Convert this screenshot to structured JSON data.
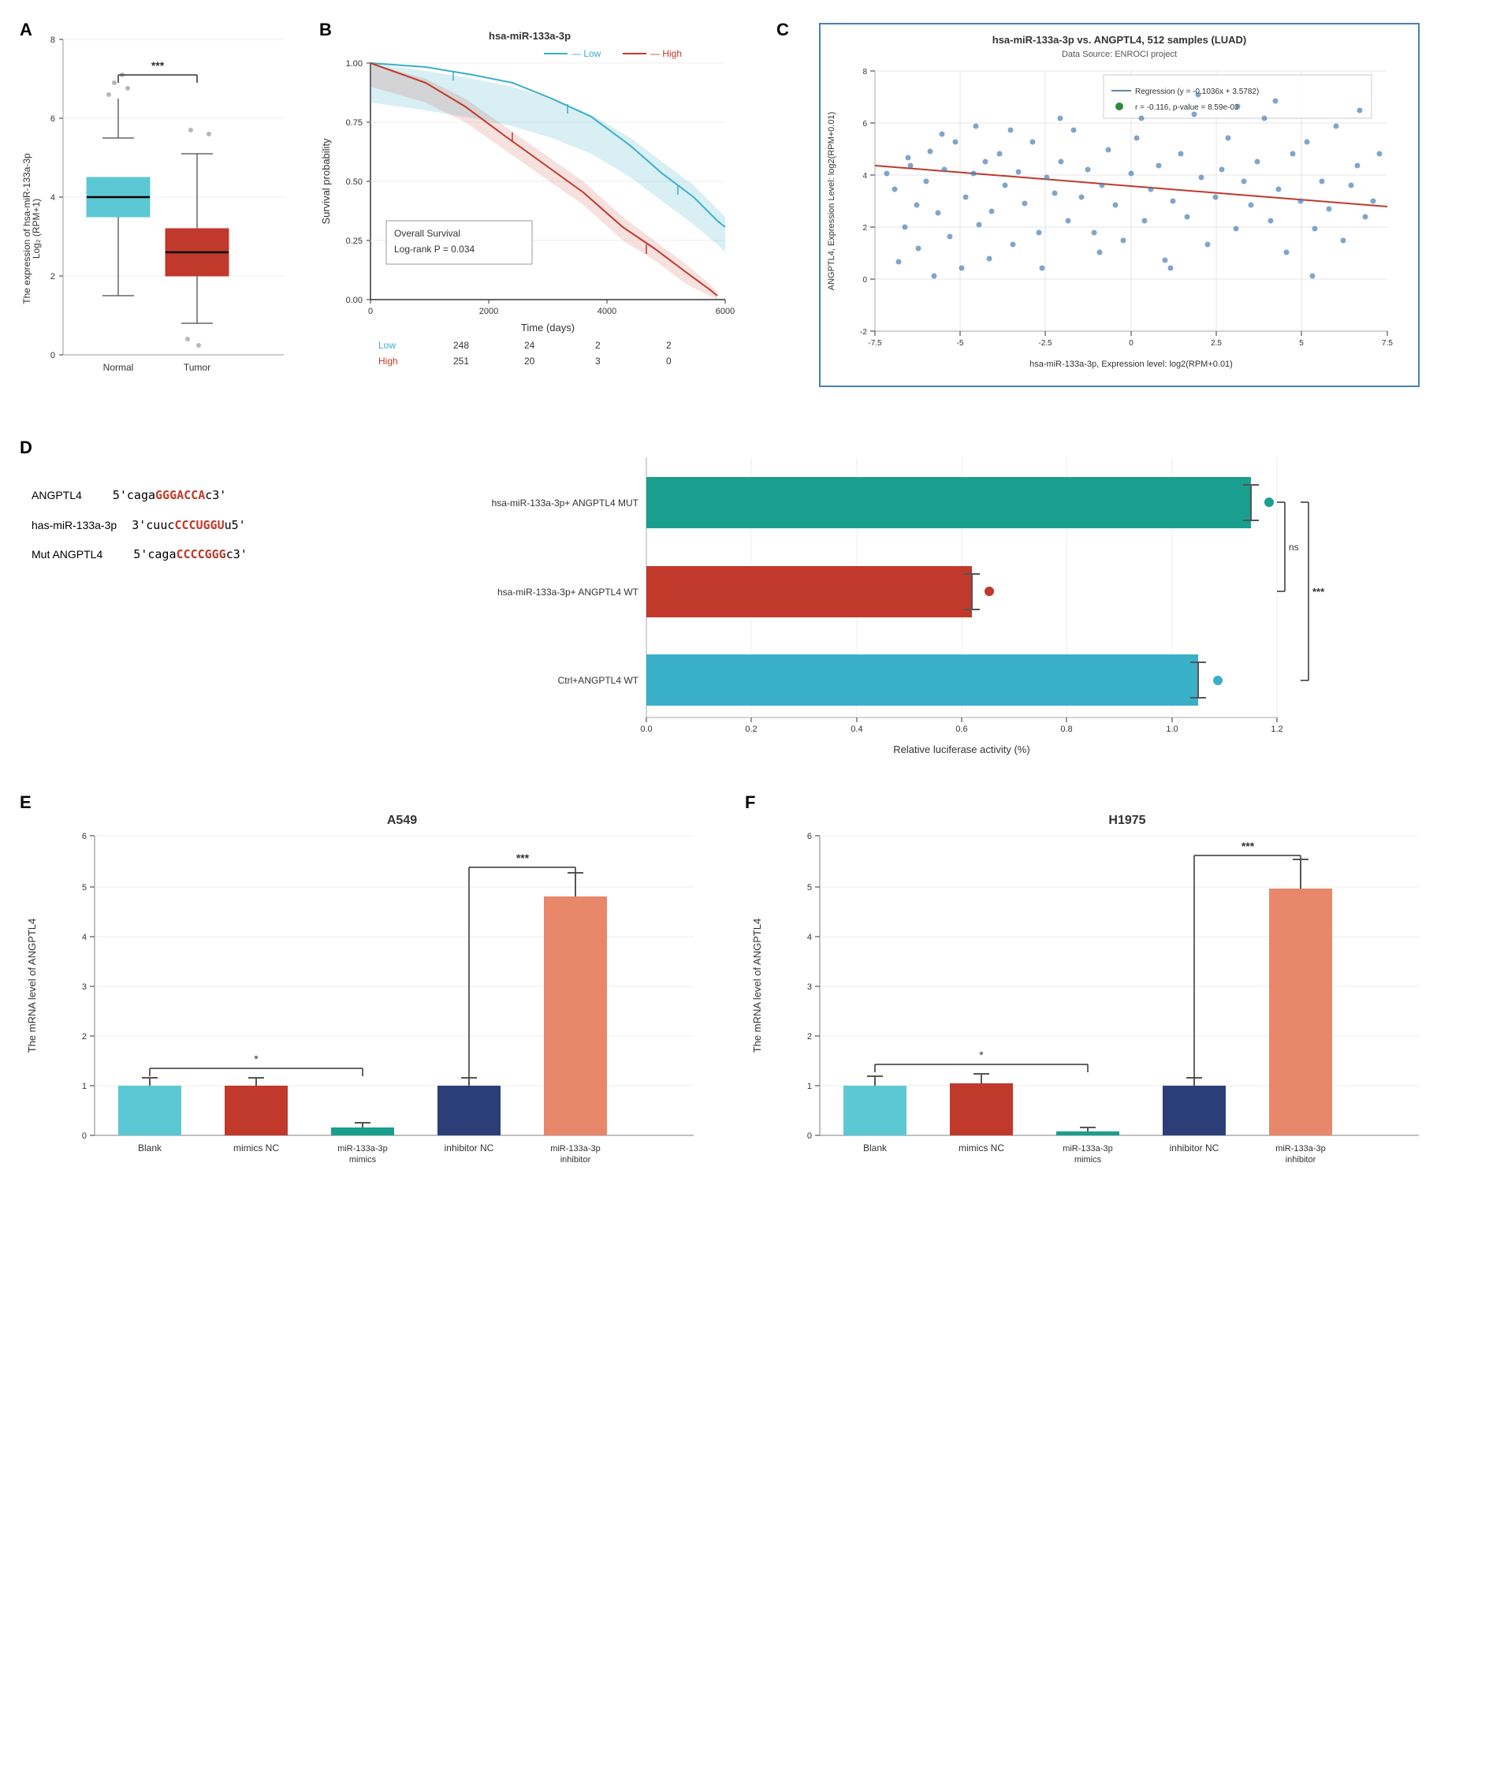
{
  "panels": {
    "A": {
      "label": "A",
      "title": "The expression of hsa-miR-133a-3p",
      "y_axis": "The expression of hsa-miR-133a-3p\nLog₂ (RPM+1)",
      "x_labels": [
        "Normal",
        "Tumor"
      ],
      "significance": "***",
      "colors": {
        "normal_box": "#5bc8d4",
        "tumor_box": "#c0392b"
      }
    },
    "B": {
      "label": "B",
      "title": "hsa-miR-133a-3p",
      "subtitle": "Overall Survival\nLog-rank P = 0.034",
      "y_axis": "Survival probability",
      "x_axis": "Time (days)",
      "legend": [
        {
          "label": "Low",
          "color": "#3aafc8"
        },
        {
          "label": "High",
          "color": "#c0392b"
        }
      ],
      "table": {
        "headers": [
          "",
          "248",
          "24",
          "2",
          "2"
        ],
        "row1": {
          "label": "Low",
          "color": "#3aafc8",
          "values": [
            "248",
            "24",
            "2",
            "2"
          ]
        },
        "row2": {
          "label": "High",
          "color": "#c0392b",
          "values": [
            "251",
            "20",
            "3",
            "0"
          ]
        }
      },
      "x_ticks": [
        "0",
        "2000",
        "4000",
        "6000"
      ],
      "y_ticks": [
        "0.00",
        "0.25",
        "0.50",
        "0.75",
        "1.00"
      ]
    },
    "C": {
      "label": "C",
      "title": "hsa-miR-133a-3p vs. ANGPTL4, 512 samples (LUAD)",
      "subtitle": "Data Source: ENROCI project",
      "regression_label": "Regression (y = -0.1036x + 3.5782)",
      "r_label": "r = -0.116, p-value = 8.59e-03",
      "x_axis": "hsa-miR-133a-3p, Expression level: log2(RPM+0.01)",
      "y_axis": "ANGPTL4, Expression Level: log2(RPM+0.01)",
      "x_range": [
        "-7.5",
        "-5",
        "-2.5",
        "0",
        "2.5",
        "5",
        "7.5"
      ],
      "y_range": [
        "-2",
        "0",
        "2",
        "4",
        "6",
        "8"
      ]
    },
    "D": {
      "label": "D",
      "sequences": [
        {
          "name": "ANGPTL4",
          "prefix": "5'caga",
          "highlight": "GGGACCA",
          "suffix": "c3'",
          "highlight_color": "#c0392b"
        },
        {
          "name": "has-miR-133a-3p",
          "prefix": "3'cuuc",
          "highlight": "CCCUGGU",
          "suffix": "u5'",
          "highlight_color": "#c0392b"
        },
        {
          "name": "Mut ANGPTL4",
          "prefix": "5'caga",
          "highlight": "CCCCGGG",
          "suffix": "c3'",
          "highlight_color": "#c0392b"
        }
      ],
      "bars": [
        {
          "label": "hsa-miR-133a-3p+ ANGPTL4 MUT",
          "value": 1.15,
          "color": "#1a9e8e",
          "dot_color": "#1a9e8e"
        },
        {
          "label": "hsa-miR-133a-3p+ ANGPTL4 WT",
          "value": 0.62,
          "color": "#c0392b",
          "dot_color": "#c0392b"
        },
        {
          "label": "Ctrl+ANGPTL4 WT",
          "value": 1.05,
          "color": "#3aafc8",
          "dot_color": "#3aafc8"
        }
      ],
      "x_axis": "Relative luciferase activity (%)",
      "x_ticks": [
        "0.0",
        "0.2",
        "0.4",
        "0.6",
        "0.8",
        "1.0",
        "1.2"
      ],
      "annotations": [
        "ns",
        "***"
      ]
    },
    "E": {
      "label": "E",
      "title": "A549",
      "y_axis": "The mRNA level of ANGPTL4",
      "x_labels": [
        "Blank",
        "mimics NC",
        "miR-133a-3p mimics",
        "inhibitor NC",
        "miR-133a-3p inhibitor"
      ],
      "bars": [
        {
          "value": 1.0,
          "color": "#5bc8d4"
        },
        {
          "value": 1.0,
          "color": "#c0392b"
        },
        {
          "value": 0.15,
          "color": "#1a9e8e"
        },
        {
          "value": 1.0,
          "color": "#2c3e78"
        },
        {
          "value": 4.8,
          "color": "#e8876a"
        }
      ],
      "y_ticks": [
        "0",
        "1",
        "2",
        "3",
        "4",
        "5",
        "6"
      ],
      "annotations": [
        {
          "from": 0,
          "to": 2,
          "label": "*"
        },
        {
          "from": 3,
          "to": 4,
          "label": "***"
        }
      ]
    },
    "F": {
      "label": "F",
      "title": "H1975",
      "y_axis": "The mRNA level of ANGPTL4",
      "x_labels": [
        "Blank",
        "mimics NC",
        "miR-133a-3p mimics",
        "inhibitor NC",
        "miR-133a-3p inhibitor"
      ],
      "bars": [
        {
          "value": 1.0,
          "color": "#5bc8d4"
        },
        {
          "value": 1.05,
          "color": "#c0392b"
        },
        {
          "value": 0.08,
          "color": "#1a9e8e"
        },
        {
          "value": 1.0,
          "color": "#2c3e78"
        },
        {
          "value": 4.95,
          "color": "#e8876a"
        }
      ],
      "y_ticks": [
        "0",
        "1",
        "2",
        "3",
        "4",
        "5",
        "6"
      ],
      "annotations": [
        {
          "from": 0,
          "to": 2,
          "label": "*"
        },
        {
          "from": 3,
          "to": 4,
          "label": "***"
        }
      ]
    }
  }
}
